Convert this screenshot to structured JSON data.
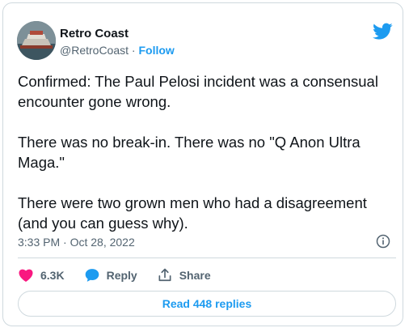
{
  "author": {
    "name": "Retro Coast",
    "handle": "@RetroCoast",
    "separator": "·",
    "follow_label": "Follow"
  },
  "tweet": {
    "paragraphs": [
      "Confirmed: The Paul Pelosi incident was a consensual encounter gone wrong.",
      "There was no break-in. There was no \"Q Anon Ultra Maga.\"",
      "There were two grown men who had a disagreement (and you can guess why)."
    ]
  },
  "timestamp": "3:33 PM · Oct 28, 2022",
  "actions": {
    "like_count": "6.3K",
    "reply_label": "Reply",
    "share_label": "Share"
  },
  "read_replies_label": "Read 448 replies",
  "icons": {
    "brand": "twitter-bird-icon",
    "info": "info-icon",
    "like": "heart-icon",
    "reply": "speech-bubble-icon",
    "share": "share-icon"
  },
  "colors": {
    "accent": "#1d9bf0",
    "like": "#f91880",
    "text": "#0f1419",
    "secondary": "#536471",
    "border": "#cfd9de"
  }
}
